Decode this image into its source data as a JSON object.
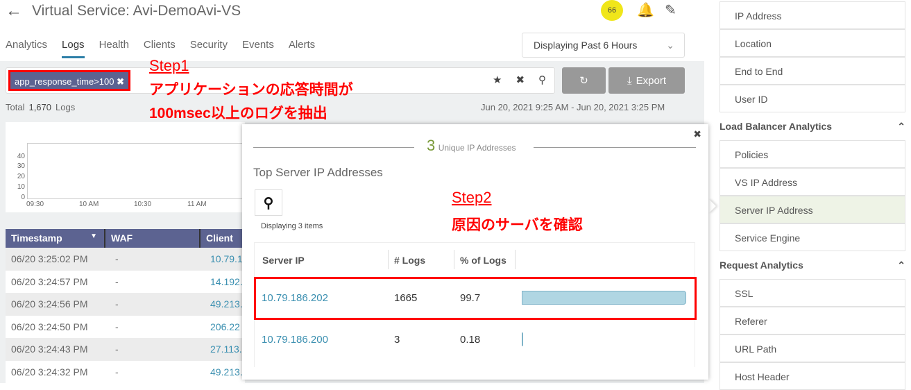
{
  "header": {
    "title": "Virtual Service:  Avi-DemoAvi-VS",
    "health_score": "66",
    "badge_color": "#f0e61a"
  },
  "tabs": [
    {
      "label": "Analytics"
    },
    {
      "label": "Logs",
      "active": true
    },
    {
      "label": "Health"
    },
    {
      "label": "Clients"
    },
    {
      "label": "Security"
    },
    {
      "label": "Events"
    },
    {
      "label": "Alerts"
    }
  ],
  "time_range": {
    "value": "Displaying  Past 6 Hours"
  },
  "search": {
    "chip": "app_response_time>100"
  },
  "toolbar": {
    "export_label": "Export"
  },
  "summary": {
    "total_label": "Total",
    "total": "1,670",
    "unit": "Logs",
    "date_range": "Jun 20, 2021 9:25 AM - Jun 20, 2021 3:25 PM"
  },
  "annotations": {
    "step1": "Step1",
    "step1_line1": "アプリケーションの応答時間が",
    "step1_line2": "100msec以上のログを抽出",
    "step2": "Step2",
    "step2_line1": "原因のサーバを確認"
  },
  "chart": {
    "y_ticks": [
      "40",
      "30",
      "20",
      "10",
      "0"
    ],
    "x_ticks": [
      "09:30",
      "10 AM",
      "10:30",
      "11 AM"
    ]
  },
  "logs_table": {
    "columns": [
      "Timestamp",
      "WAF",
      "Client"
    ],
    "rows": [
      [
        "06/20 3:25:02 PM",
        "-",
        "10.79.1"
      ],
      [
        "06/20 3:24:57 PM",
        "-",
        "14.192."
      ],
      [
        "06/20 3:24:56 PM",
        "-",
        "49.213."
      ],
      [
        "06/20 3:24:50 PM",
        "-",
        "206.22"
      ],
      [
        "06/20 3:24:43 PM",
        "-",
        "27.113.2"
      ],
      [
        "06/20 3:24:32 PM",
        "-",
        "49.213."
      ]
    ]
  },
  "popup": {
    "unique_count": "3",
    "unique_label": "Unique IP Addresses",
    "title": "Top Server IP Addresses",
    "displaying": "Displaying 3 items",
    "columns": [
      "Server IP",
      "# Logs",
      "% of Logs"
    ],
    "rows": [
      {
        "ip": "10.79.186.202",
        "logs": "1665",
        "pct": "99.7",
        "fraction": 0.997
      },
      {
        "ip": "10.79.186.200",
        "logs": "3",
        "pct": "0.18",
        "fraction": 0.0018
      }
    ]
  },
  "sidebar": {
    "group1": [
      "IP Address",
      "Location",
      "End to End",
      "User ID"
    ],
    "lb_header": "Load Balancer Analytics",
    "lb_items": [
      "Policies",
      "VS IP Address",
      "Server IP Address",
      "Service Engine"
    ],
    "req_header": "Request Analytics",
    "req_items": [
      "SSL",
      "Referer",
      "URL Path",
      "Host Header"
    ],
    "selected": "Server IP Address"
  }
}
